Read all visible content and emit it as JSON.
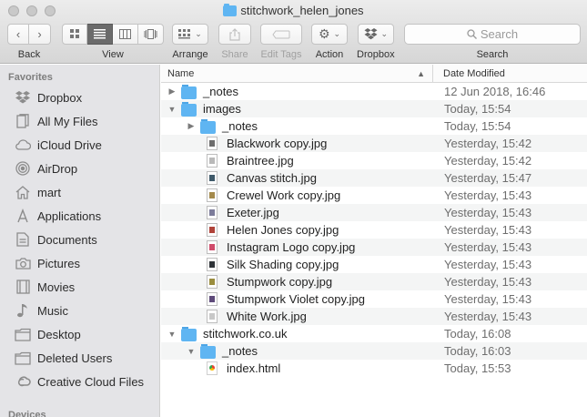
{
  "window": {
    "title": "stitchwork_helen_jones"
  },
  "toolbar": {
    "back_label": "Back",
    "view_label": "View",
    "arrange_label": "Arrange",
    "share_label": "Share",
    "edit_tags_label": "Edit Tags",
    "action_label": "Action",
    "dropbox_label": "Dropbox",
    "search_placeholder": "Search",
    "search_label": "Search"
  },
  "sidebar": {
    "favorites_heading": "Favorites",
    "devices_heading": "Devices",
    "items": [
      {
        "label": "Dropbox",
        "icon": "dropbox-icon"
      },
      {
        "label": "All My Files",
        "icon": "all-files-icon"
      },
      {
        "label": "iCloud Drive",
        "icon": "cloud-icon"
      },
      {
        "label": "AirDrop",
        "icon": "airdrop-icon"
      },
      {
        "label": "mart",
        "icon": "home-icon"
      },
      {
        "label": "Applications",
        "icon": "applications-icon"
      },
      {
        "label": "Documents",
        "icon": "documents-icon"
      },
      {
        "label": "Pictures",
        "icon": "camera-icon"
      },
      {
        "label": "Movies",
        "icon": "film-icon"
      },
      {
        "label": "Music",
        "icon": "music-note-icon"
      },
      {
        "label": "Desktop",
        "icon": "desktop-icon"
      },
      {
        "label": "Deleted Users",
        "icon": "folder-icon"
      },
      {
        "label": "Creative Cloud Files",
        "icon": "creative-cloud-icon"
      }
    ]
  },
  "columns": {
    "name": "Name",
    "date": "Date Modified"
  },
  "rows": [
    {
      "name": "_notes",
      "date": "12 Jun 2018, 16:46"
    },
    {
      "name": "images",
      "date": "Today, 15:54"
    },
    {
      "name": "_notes",
      "date": "Today, 15:54"
    },
    {
      "name": "Blackwork copy.jpg",
      "date": "Yesterday, 15:42"
    },
    {
      "name": "Braintree.jpg",
      "date": "Yesterday, 15:42"
    },
    {
      "name": "Canvas stitch.jpg",
      "date": "Yesterday, 15:47"
    },
    {
      "name": "Crewel Work copy.jpg",
      "date": "Yesterday, 15:43"
    },
    {
      "name": "Exeter.jpg",
      "date": "Yesterday, 15:43"
    },
    {
      "name": "Helen Jones copy.jpg",
      "date": "Yesterday, 15:43"
    },
    {
      "name": "Instagram Logo copy.jpg",
      "date": "Yesterday, 15:43"
    },
    {
      "name": "Silk Shading copy.jpg",
      "date": "Yesterday, 15:43"
    },
    {
      "name": "Stumpwork copy.jpg",
      "date": "Yesterday, 15:43"
    },
    {
      "name": "Stumpwork Violet copy.jpg",
      "date": "Yesterday, 15:43"
    },
    {
      "name": "White Work.jpg",
      "date": "Yesterday, 15:43"
    },
    {
      "name": "stitchwork.co.uk",
      "date": "Today, 16:08"
    },
    {
      "name": "_notes",
      "date": "Today, 16:03"
    },
    {
      "name": "index.html",
      "date": "Today, 15:53"
    }
  ],
  "colors": {
    "folder": "#5fb5f2",
    "sidebar_bg": "#e4e4e7"
  }
}
